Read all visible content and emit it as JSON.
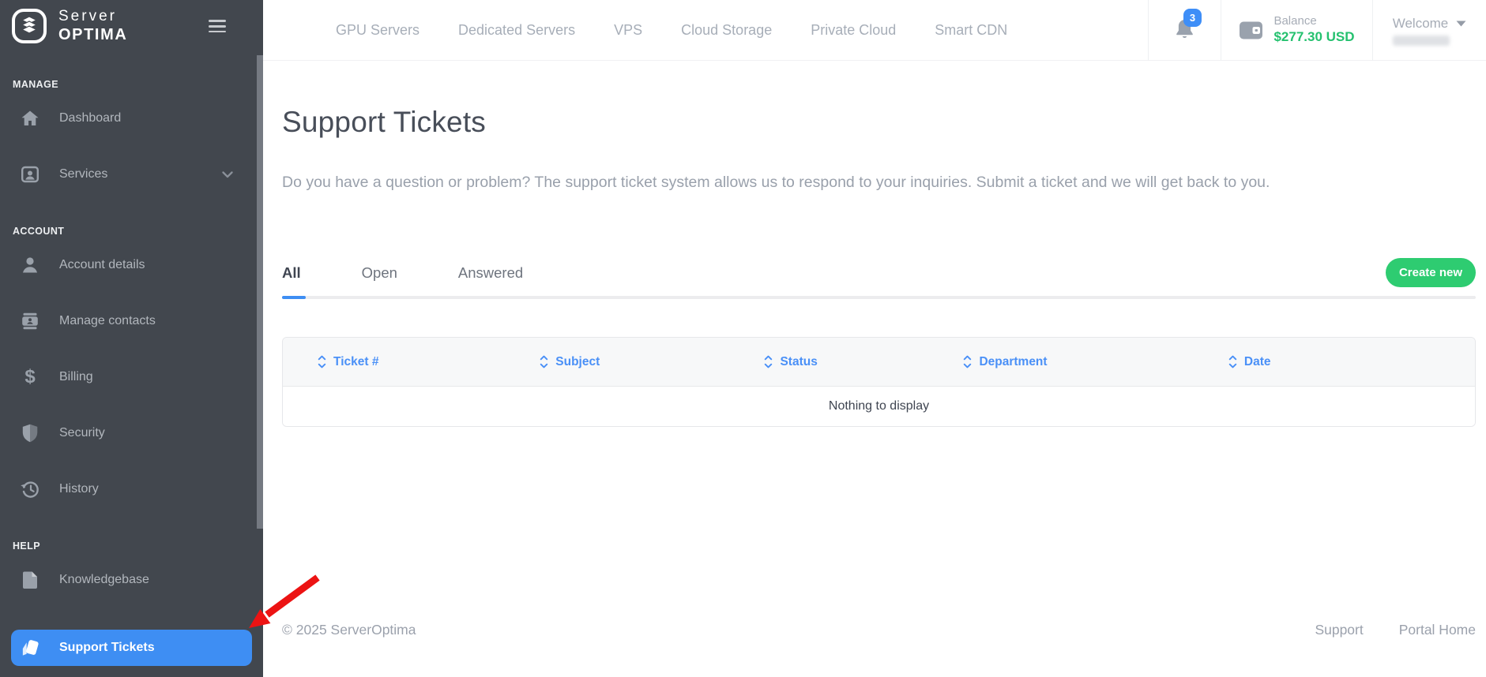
{
  "brand": {
    "name_top": "Server",
    "name_bottom": "OPTIMA"
  },
  "sidebar": {
    "sections": [
      {
        "title": "MANAGE",
        "items": [
          {
            "label": "Dashboard"
          },
          {
            "label": "Services"
          }
        ]
      },
      {
        "title": "ACCOUNT",
        "items": [
          {
            "label": "Account details"
          },
          {
            "label": "Manage contacts"
          },
          {
            "label": "Billing"
          },
          {
            "label": "Security"
          },
          {
            "label": "History"
          }
        ]
      },
      {
        "title": "HELP",
        "items": [
          {
            "label": "Knowledgebase"
          },
          {
            "label": "Support Tickets",
            "active": true
          }
        ]
      }
    ]
  },
  "header": {
    "nav": [
      {
        "label": "GPU Servers"
      },
      {
        "label": "Dedicated Servers"
      },
      {
        "label": "VPS"
      },
      {
        "label": "Cloud Storage"
      },
      {
        "label": "Private Cloud"
      },
      {
        "label": "Smart CDN"
      }
    ],
    "notifications": {
      "count": "3"
    },
    "balance": {
      "label": "Balance",
      "amount": "$277.30 USD"
    },
    "user": {
      "greeting": "Welcome"
    }
  },
  "page": {
    "title": "Support Tickets",
    "description": "Do you have a question or problem? The support ticket system allows us to respond to your inquiries. Submit a ticket and we will get back to you.",
    "tabs": [
      {
        "label": "All"
      },
      {
        "label": "Open"
      },
      {
        "label": "Answered"
      }
    ],
    "create_button": "Create new",
    "table": {
      "columns": [
        "Ticket #",
        "Subject",
        "Status",
        "Department",
        "Date"
      ],
      "empty_message": "Nothing to display"
    }
  },
  "footer": {
    "copyright": "© 2025 ServerOptima",
    "links": [
      "Support",
      "Portal Home"
    ]
  },
  "icons": {
    "logo": "layers-stack",
    "menu": "hamburger",
    "dashboard": "home",
    "services": "id-badge",
    "account_details": "person",
    "manage_contacts": "contact-card",
    "billing": "dollar-sign",
    "security": "shield",
    "history": "clock-restore",
    "knowledgebase": "document",
    "support_tickets": "tickets",
    "notifications": "bell",
    "balance": "wallet",
    "user_menu": "caret-down",
    "sort": "up-down-chevrons",
    "annotation": "red-arrow"
  },
  "colors": {
    "sidebar_bg": "#42474e",
    "accent_blue": "#3e8ef3",
    "table_header_blue": "#4a90f7",
    "accent_green": "#2ecc71",
    "balance_green": "#25c16f",
    "annotation_red": "#ec1313"
  }
}
